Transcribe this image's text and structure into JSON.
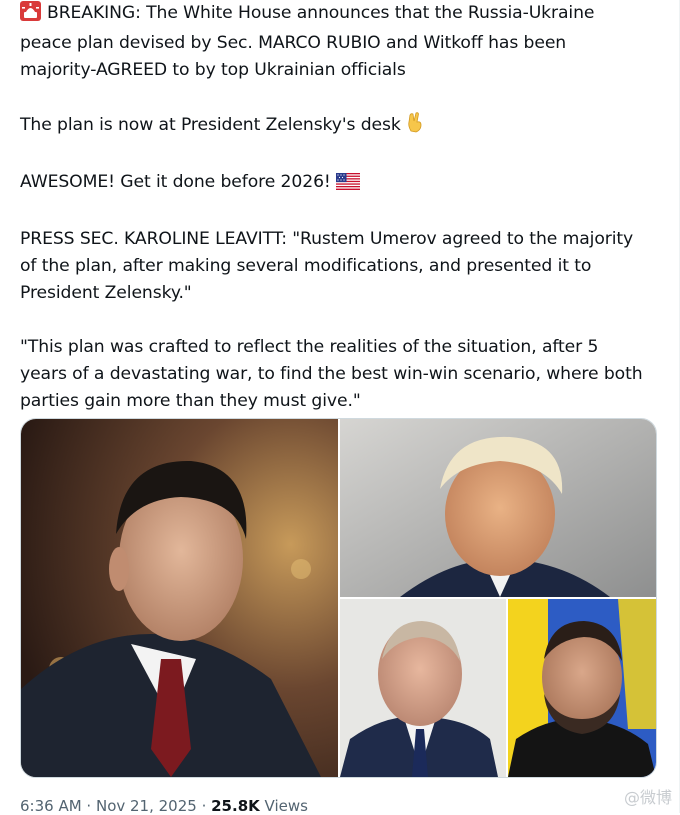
{
  "post": {
    "line1": "BREAKING: The White House announces that the Russia-Ukraine",
    "line2": "peace plan devised by Sec. MARCO RUBIO and Witkoff has been",
    "line3": "majority-AGREED to by top Ukrainian officials",
    "para2": "The plan is now at President Zelensky's desk",
    "para3": "AWESOME! Get it done before 2026!",
    "para4_l1": "PRESS SEC. KAROLINE LEAVITT: \"Rustem Umerov agreed to the majority",
    "para4_l2": "of the plan, after making several modifications, and presented it to",
    "para4_l3": "President Zelensky.\"",
    "para5_l1": "\"This plan was crafted to reflect the realities of the situation, after 5",
    "para5_l2": "years of a devastating war, to find the best win-win scenario, where both",
    "para5_l3": "parties gain more than they must give.\""
  },
  "icons": {
    "siren": "rotating-light-emoji",
    "fingers": "crossed-fingers-emoji",
    "flag": "us-flag-emoji"
  },
  "meta": {
    "time": "6:36 AM",
    "sep1": " · ",
    "date": "Nov 21, 2025",
    "sep2": " · ",
    "views_count": "25.8K",
    "views_label": " Views"
  },
  "watermark": "@微博"
}
